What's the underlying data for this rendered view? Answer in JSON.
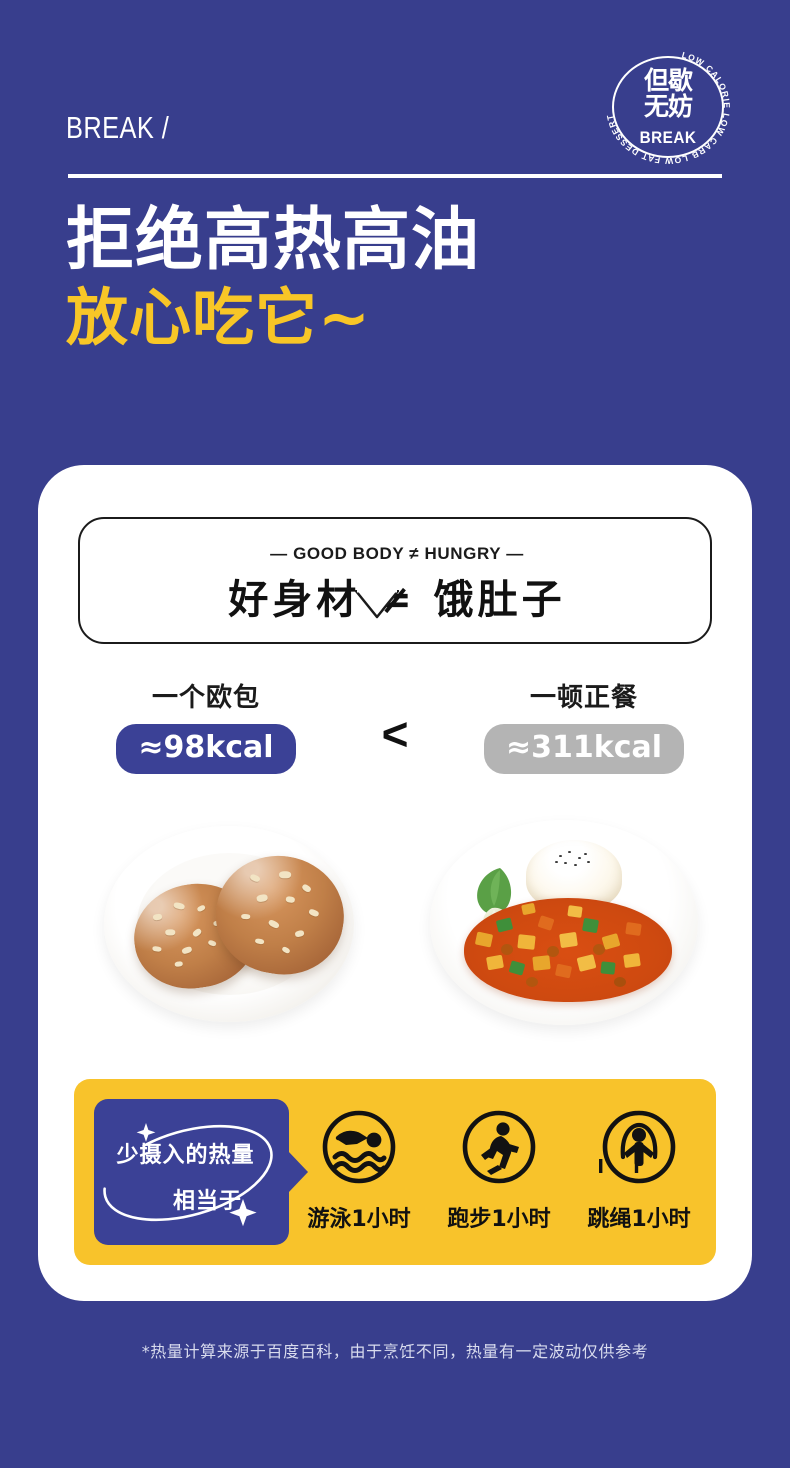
{
  "brand": {
    "wordmark": "BREAK /",
    "logo": {
      "cn_top": "但歇",
      "cn_bottom": "无妨",
      "latin": "BREAK",
      "ring_text": "LOW CALORIE LOW CARB LOW FAT DESSERT",
      "ring_icon": "circular-stamp-icon"
    }
  },
  "headline": {
    "line1": "拒绝高热高油",
    "line2": "放心吃它~"
  },
  "bubble": {
    "subtitle": "— GOOD BODY ≠ HUNGRY —",
    "title": "好身材 ≠ 饿肚子",
    "tail_icon": "speech-bubble-tail-icon"
  },
  "comparison": {
    "operator": "<",
    "left": {
      "label": "一个欧包",
      "calories": "≈98kcal",
      "photo_icon": "bread-rolls-photo",
      "pill_color": "#3B4196"
    },
    "right": {
      "label": "一顿正餐",
      "calories": "≈311kcal",
      "photo_icon": "rice-meal-photo",
      "pill_color": "#B4B4B4"
    }
  },
  "exercise_band": {
    "badge_line1": "少摄入的热量",
    "badge_line2": "相当于",
    "badge_deco_icon": "orbit-sparkle-decoration",
    "band_color": "#F8C32B",
    "badge_color": "#3B4196",
    "activities": [
      {
        "icon": "swimming-icon",
        "label": "游泳1小时"
      },
      {
        "icon": "running-icon",
        "label": "跑步1小时"
      },
      {
        "icon": "jump-rope-icon",
        "label": "跳绳1小时"
      }
    ]
  },
  "footnote": "*热量计算来源于百度百科，由于烹饪不同，热量有一定波动仅供参考",
  "theme": {
    "background": "#383E8D",
    "card": "#FFFFFF",
    "accent_yellow": "#F8C627",
    "accent_blue": "#3B4196",
    "gray": "#B4B4B4"
  }
}
